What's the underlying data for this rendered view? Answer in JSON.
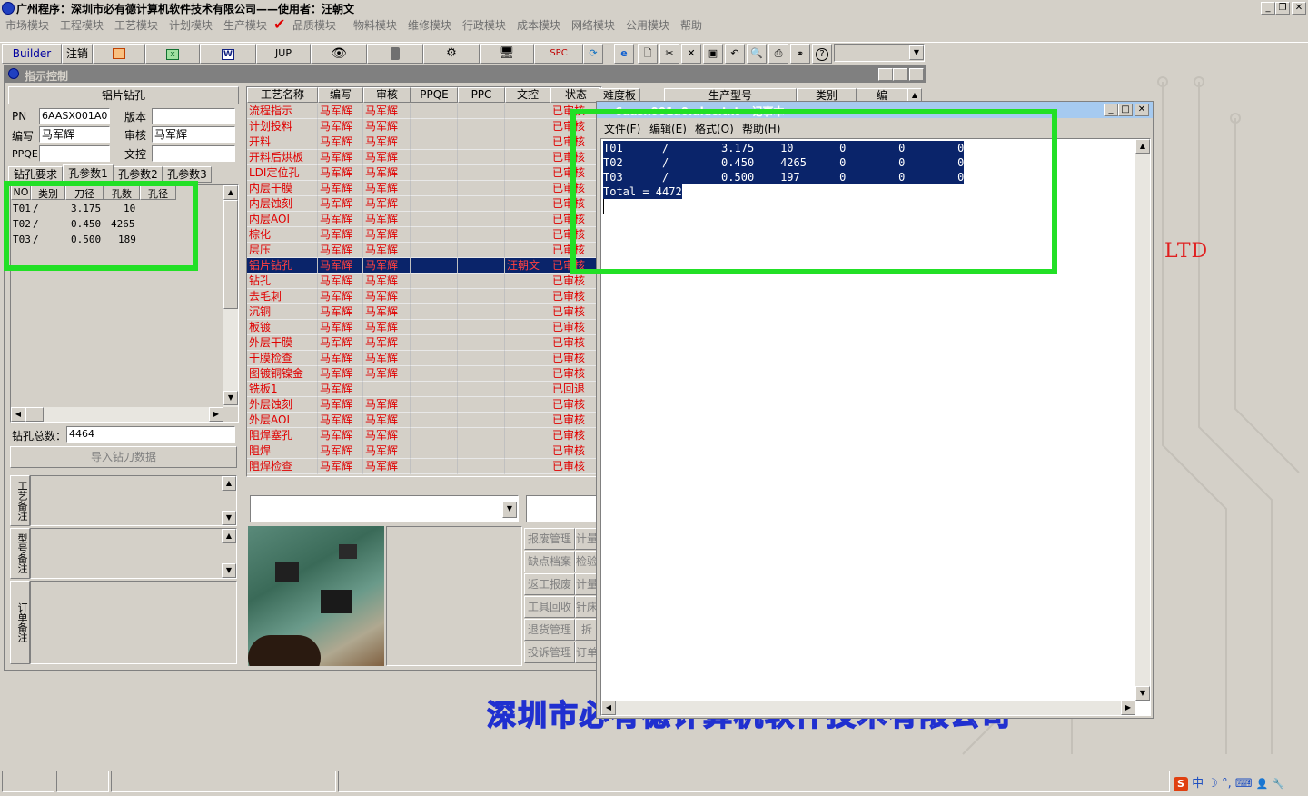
{
  "window": {
    "title": "广州程序：深圳市必有德计算机软件技术有限公司——使用者：汪朝文",
    "controls": [
      "_",
      "❐",
      "✕"
    ]
  },
  "menu": [
    "市场模块",
    "工程模块",
    "工艺模块",
    "计划模块",
    "生产模块",
    "品质模块",
    "物料模块",
    "维修模块",
    "行政模块",
    "成本模块",
    "网络模块",
    "公用模块",
    "帮助"
  ],
  "toolbar": {
    "builder": "Builder",
    "logout": "注销",
    "jup": "JUP",
    "spc": "SPC"
  },
  "inner_window": {
    "title": "指示控制"
  },
  "left_panel": {
    "header": "铝片钻孔",
    "pn_label": "PN",
    "pn_value": "6AASX001A0",
    "version_label": "版本",
    "author_label": "编写",
    "author_value": "马军辉",
    "review_label": "审核",
    "review_value": "马军辉",
    "ppqe_label": "PPQE",
    "control_label": "文控",
    "tabs": [
      "钻孔要求",
      "孔参数1",
      "孔参数2",
      "孔参数3"
    ],
    "hole_table": {
      "headers": [
        "NO",
        "类别",
        "刀径",
        "孔数",
        "孔径"
      ],
      "rows": [
        [
          "T01",
          "/",
          "3.175",
          "10",
          ""
        ],
        [
          "T02",
          "/",
          "0.450",
          "4265",
          ""
        ],
        [
          "T03",
          "/",
          "0.500",
          "189",
          ""
        ]
      ]
    },
    "total_label": "钻孔总数：",
    "total_value": "4464",
    "import_button": "导入钻刀数据",
    "notes": [
      "工艺备注",
      "型号备注",
      "订单备注"
    ]
  },
  "process_grid": {
    "headers": [
      "工艺名称",
      "编写",
      "审核",
      "PPQE",
      "PPC",
      "文控",
      "状态"
    ],
    "rows": [
      {
        "name": "流程指示",
        "author": "马军辉",
        "review": "马军辉",
        "ppqe": "",
        "ppc": "",
        "control": "",
        "status": "已审核"
      },
      {
        "name": "计划投料",
        "author": "马军辉",
        "review": "马军辉",
        "ppqe": "",
        "ppc": "",
        "control": "",
        "status": "已审核"
      },
      {
        "name": "开料",
        "author": "马军辉",
        "review": "马军辉",
        "ppqe": "",
        "ppc": "",
        "control": "",
        "status": "已审核"
      },
      {
        "name": "开料后烘板",
        "author": "马军辉",
        "review": "马军辉",
        "ppqe": "",
        "ppc": "",
        "control": "",
        "status": "已审核"
      },
      {
        "name": "LDI定位孔",
        "author": "马军辉",
        "review": "马军辉",
        "ppqe": "",
        "ppc": "",
        "control": "",
        "status": "已审核"
      },
      {
        "name": "内层干膜",
        "author": "马军辉",
        "review": "马军辉",
        "ppqe": "",
        "ppc": "",
        "control": "",
        "status": "已审核"
      },
      {
        "name": "内层蚀刻",
        "author": "马军辉",
        "review": "马军辉",
        "ppqe": "",
        "ppc": "",
        "control": "",
        "status": "已审核"
      },
      {
        "name": "内层AOI",
        "author": "马军辉",
        "review": "马军辉",
        "ppqe": "",
        "ppc": "",
        "control": "",
        "status": "已审核"
      },
      {
        "name": "棕化",
        "author": "马军辉",
        "review": "马军辉",
        "ppqe": "",
        "ppc": "",
        "control": "",
        "status": "已审核"
      },
      {
        "name": "层压",
        "author": "马军辉",
        "review": "马军辉",
        "ppqe": "",
        "ppc": "",
        "control": "",
        "status": "已审核"
      },
      {
        "name": "铝片钻孔",
        "author": "马军辉",
        "review": "马军辉",
        "ppqe": "",
        "ppc": "",
        "control": "汪朝文",
        "status": "已审核",
        "selected": true
      },
      {
        "name": "钻孔",
        "author": "马军辉",
        "review": "马军辉",
        "ppqe": "",
        "ppc": "",
        "control": "",
        "status": "已审核"
      },
      {
        "name": "去毛刺",
        "author": "马军辉",
        "review": "马军辉",
        "ppqe": "",
        "ppc": "",
        "control": "",
        "status": "已审核"
      },
      {
        "name": "沉铜",
        "author": "马军辉",
        "review": "马军辉",
        "ppqe": "",
        "ppc": "",
        "control": "",
        "status": "已审核"
      },
      {
        "name": "板镀",
        "author": "马军辉",
        "review": "马军辉",
        "ppqe": "",
        "ppc": "",
        "control": "",
        "status": "已审核"
      },
      {
        "name": "外层干膜",
        "author": "马军辉",
        "review": "马军辉",
        "ppqe": "",
        "ppc": "",
        "control": "",
        "status": "已审核"
      },
      {
        "name": "干膜检查",
        "author": "马军辉",
        "review": "马军辉",
        "ppqe": "",
        "ppc": "",
        "control": "",
        "status": "已审核"
      },
      {
        "name": "图镀铜镍金",
        "author": "马军辉",
        "review": "马军辉",
        "ppqe": "",
        "ppc": "",
        "control": "",
        "status": "已审核"
      },
      {
        "name": "铣板1",
        "author": "马军辉",
        "review": "",
        "ppqe": "",
        "ppc": "",
        "control": "",
        "status": "已回退"
      },
      {
        "name": "外层蚀刻",
        "author": "马军辉",
        "review": "马军辉",
        "ppqe": "",
        "ppc": "",
        "control": "",
        "status": "已审核"
      },
      {
        "name": "外层AOI",
        "author": "马军辉",
        "review": "马军辉",
        "ppqe": "",
        "ppc": "",
        "control": "",
        "status": "已审核"
      },
      {
        "name": "阻焊塞孔",
        "author": "马军辉",
        "review": "马军辉",
        "ppqe": "",
        "ppc": "",
        "control": "",
        "status": "已审核"
      },
      {
        "name": "阻焊",
        "author": "马军辉",
        "review": "马军辉",
        "ppqe": "",
        "ppc": "",
        "control": "",
        "status": "已审核"
      },
      {
        "name": "阻焊检查",
        "author": "马军辉",
        "review": "马军辉",
        "ppqe": "",
        "ppc": "",
        "control": "",
        "status": "已审核"
      }
    ]
  },
  "right_grid_headers": [
    "难度板",
    "生产型号",
    "类别",
    "编"
  ],
  "side_buttons": [
    [
      "报废管理",
      "计量"
    ],
    [
      "缺点档案",
      "检验"
    ],
    [
      "返工报废",
      "计量"
    ],
    [
      "工具回收",
      "针床"
    ],
    [
      "退货管理",
      "拆"
    ],
    [
      "投诉管理",
      "订单"
    ]
  ],
  "notepad": {
    "title": "6aasx001a0.aluc.txt - 记事本",
    "menu": [
      "文件(F)",
      "编辑(E)",
      "格式(O)",
      "帮助(H)"
    ],
    "lines": [
      "T01      /        3.175    10       0        0        0",
      "T02      /        0.450    4265     0        0        0",
      "T03      /        0.500    197      0        0        0",
      "Total = 4472"
    ]
  },
  "background_text": {
    "ltd": "LTD",
    "company_watermark": "深圳市必有德计算机软件技术有限公司"
  },
  "tray": [
    "S",
    "中",
    "☽",
    "°,",
    "⌨",
    "👤",
    "🔧"
  ]
}
